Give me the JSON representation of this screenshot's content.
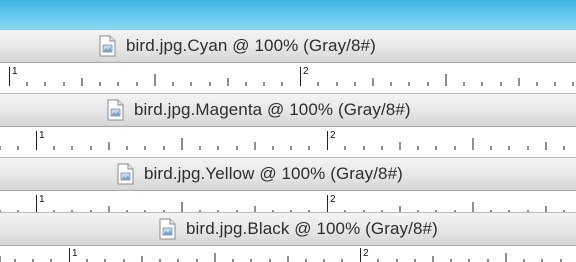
{
  "topbar": {
    "color": "#52bde9"
  },
  "windows": [
    {
      "title": "bird.jpg.Cyan @ 100% (Gray/8#)",
      "ruler_labels": [
        "1",
        "2"
      ]
    },
    {
      "title": "bird.jpg.Magenta @ 100% (Gray/8#)",
      "ruler_labels": [
        "1",
        "2"
      ]
    },
    {
      "title": "bird.jpg.Yellow @ 100% (Gray/8#)",
      "ruler_labels": [
        "1",
        "2"
      ]
    },
    {
      "title": "bird.jpg.Black @ 100% (Gray/8#)",
      "ruler_labels": [
        "1",
        "2"
      ]
    }
  ],
  "icons": {
    "document": "document-image-icon"
  }
}
